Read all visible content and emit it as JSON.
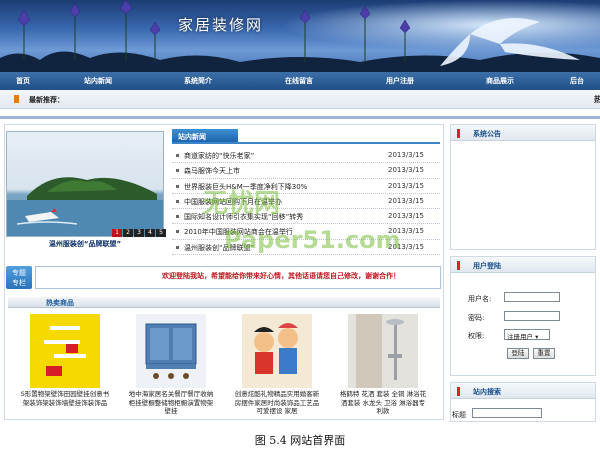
{
  "site": {
    "title": "家居装修网"
  },
  "nav": {
    "items": [
      "首页",
      "站内新闻",
      "系统简介",
      "在线留言",
      "用户注册",
      "商品展示",
      "后台"
    ]
  },
  "latest": {
    "label": "最新推荐：",
    "edge_char": "热"
  },
  "slideshow": {
    "caption": "温州服装创“品牌联盟”",
    "pages": [
      "1",
      "2",
      "3",
      "4",
      "5"
    ],
    "active": "1"
  },
  "news": {
    "title": "站内新闻",
    "items": [
      {
        "title": "商道家纺的“快乐老家”",
        "date": "2013/3/15"
      },
      {
        "title": "森马服饰今天上市",
        "date": "2013/3/15"
      },
      {
        "title": "世界服装巨头H&M一季度净利下降30%",
        "date": "2013/3/15"
      },
      {
        "title": "中国服装网站回购下月在温举办",
        "date": "2013/3/15"
      },
      {
        "title": "国际知名设计师引衣集实现“回移”转秀",
        "date": "2013/3/15"
      },
      {
        "title": "2010年中国服装网站商会在温举行",
        "date": "2013/3/15"
      },
      {
        "title": "温州服装创“品牌联盟”",
        "date": "2013/3/15"
      }
    ]
  },
  "topic": {
    "tag": "专题专栏",
    "tag_line1": "专题",
    "tag_line2": "专栏",
    "marquee": "欢迎登陆我站，希望能给你带来好心情，其他话语请您自己修改，谢谢合作！"
  },
  "hot": {
    "title": "热卖商品",
    "products": [
      {
        "caption": "S形置物架壁饰田园壁挂创意书架装饰架装饰墙壁挂饰装饰品"
      },
      {
        "caption": "地中海家居名关餐厅餐厅收纳柜挂壁橱整储物柜橱演置物架 壁挂"
      },
      {
        "caption": "创意炫酷礼物精品实用婚客新房摆件家居时尚装饰品工艺品可爱摆设 家居"
      },
      {
        "caption": "格鹤特 花洒 套装 全铜 淋浴花洒套装 水龙头 卫浴 淋浴器专利款"
      }
    ]
  },
  "sidebar": {
    "notice": {
      "title": "系统公告"
    },
    "login": {
      "title": "用户登陆",
      "username_label": "用户名:",
      "password_label": "密码:",
      "role_label": "权限:",
      "role_value": "注册用户",
      "login_button": "登陆",
      "reset_button": "重置"
    },
    "search": {
      "title": "站内搜索",
      "field_label": "标题"
    }
  },
  "watermark": {
    "line1": "无忧网",
    "line2": "Paper51.com"
  },
  "figure_caption": "图 5.4 网站首界面"
}
